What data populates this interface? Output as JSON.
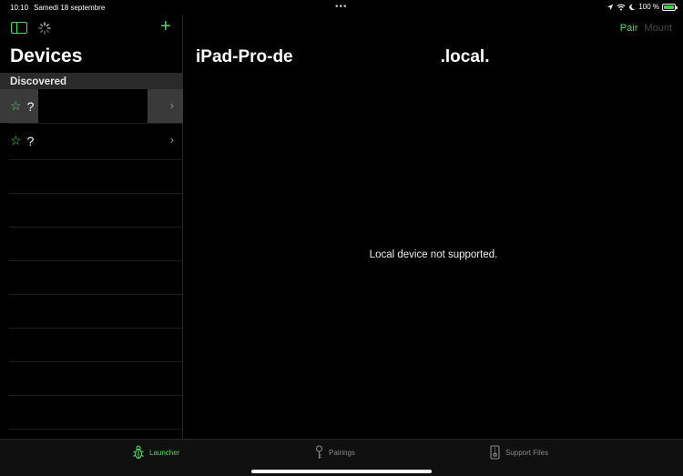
{
  "status": {
    "time": "10:10",
    "date": "Samedi 18 septembre",
    "multitask_dots": "•••",
    "battery_text": "100 %",
    "battery_level": 1.0
  },
  "sidebar": {
    "title": "Devices",
    "section_header": "Discovered",
    "devices": [
      {
        "name": "?",
        "selected": true
      },
      {
        "name": "?",
        "selected": false
      }
    ]
  },
  "detail": {
    "title_left": "iPad-Pro-de",
    "title_right": ".local.",
    "pair_label": "Pair",
    "mount_label": "Mount",
    "message": "Local device not supported."
  },
  "tabs": [
    {
      "label": "Launcher",
      "icon": "bug-icon",
      "active": true
    },
    {
      "label": "Pairings",
      "icon": "key-icon",
      "active": false
    },
    {
      "label": "Support Files",
      "icon": "zip-file-icon",
      "active": false
    }
  ],
  "colors": {
    "accent": "#4cd964",
    "background": "#000000",
    "selected_row": "#3a3a3a",
    "section_header": "#2a2a2a"
  }
}
